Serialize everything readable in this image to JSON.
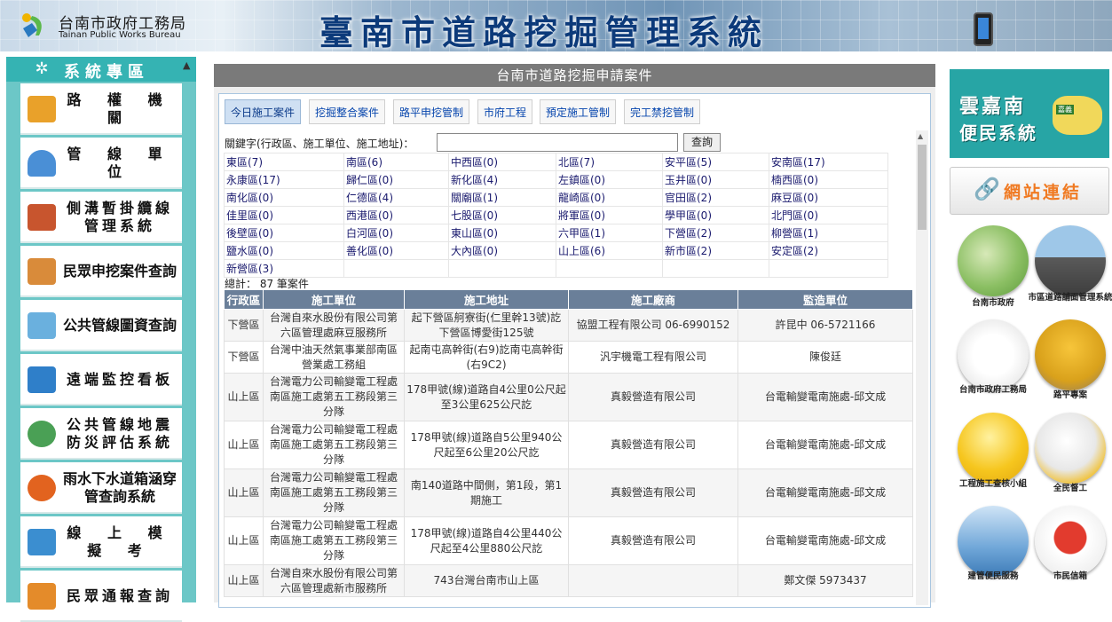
{
  "header": {
    "org_name_cn": "台南市政府工務局",
    "org_name_en": "Tainan Public Works Bureau",
    "system_title": "臺南市道路挖掘管理系統"
  },
  "sidebar": {
    "title": "系統專區",
    "items": [
      {
        "label": "路 權 機 關",
        "icon": "building-icon"
      },
      {
        "label": "管 線 單 位",
        "icon": "worker-icon"
      },
      {
        "label": "側溝暫掛纜線管理系統",
        "icon": "cable-icon"
      },
      {
        "label": "民眾申挖案件查詢",
        "icon": "folder-icon"
      },
      {
        "label": "公共管線圖資查詢",
        "icon": "map-search-icon"
      },
      {
        "label": "遠端監控看板",
        "icon": "monitor-icon"
      },
      {
        "label": "公共管線地震防災評估系統",
        "icon": "seismograph-icon"
      },
      {
        "label": "雨水下水道箱涵穿管查詢系統",
        "icon": "water-icon"
      },
      {
        "label": "線 上 模 擬 考",
        "icon": "exam-icon"
      },
      {
        "label": "民眾通報查詢",
        "icon": "report-icon"
      }
    ]
  },
  "main": {
    "title": "台南市道路挖掘申請案件",
    "tabs": [
      "今日施工案件",
      "挖掘整合案件",
      "路平申挖管制",
      "市府工程",
      "預定施工管制",
      "完工禁挖管制"
    ],
    "active_tab": "今日施工案件",
    "search": {
      "label": "關鍵字(行政區、施工單位、施工地址)：",
      "value": "",
      "button": "查詢"
    },
    "districts": [
      [
        "東區(7)",
        "南區(6)",
        "中西區(0)",
        "北區(7)",
        "安平區(5)",
        "安南區(17)"
      ],
      [
        "永康區(17)",
        "歸仁區(0)",
        "新化區(4)",
        "左鎮區(0)",
        "玉井區(0)",
        "楠西區(0)"
      ],
      [
        "南化區(0)",
        "仁德區(4)",
        "關廟區(1)",
        "龍崎區(0)",
        "官田區(2)",
        "麻豆區(0)"
      ],
      [
        "佳里區(0)",
        "西港區(0)",
        "七股區(0)",
        "將軍區(0)",
        "學甲區(0)",
        "北門區(0)"
      ],
      [
        "後壁區(0)",
        "白河區(0)",
        "東山區(0)",
        "六甲區(1)",
        "下營區(2)",
        "柳營區(1)"
      ],
      [
        "鹽水區(0)",
        "善化區(0)",
        "大內區(0)",
        "山上區(6)",
        "新市區(2)",
        "安定區(2)"
      ],
      [
        "新營區(3)",
        "",
        "",
        "",
        "",
        ""
      ]
    ],
    "total": "總計： 87 筆案件",
    "columns": [
      "行政區",
      "施工單位",
      "施工地址",
      "施工廠商",
      "監造單位"
    ],
    "rows": [
      [
        "下營區",
        "台灣自來水股份有限公司第六區管理處麻豆服務所",
        "起下營區舸寮街(仁里幹13號)訖下營區博愛街125號",
        "協盟工程有限公司 06-6990152",
        "許昆中 06-5721166"
      ],
      [
        "下營區",
        "台灣中油天然氣事業部南區營業處工務組",
        "起南屯高幹街(右9)訖南屯高幹街(右9C2)",
        "汎宇機電工程有限公司",
        "陳俊廷"
      ],
      [
        "山上區",
        "台灣電力公司輸變電工程處南區施工處第五工務段第三分隊",
        "178甲號(線)道路自4公里0公尺起至3公里625公尺訖",
        "真毅營造有限公司",
        "台電輸變電南施處-邱文成"
      ],
      [
        "山上區",
        "台灣電力公司輸變電工程處南區施工處第五工務段第三分隊",
        "178甲號(線)道路自5公里940公尺起至6公里20公尺訖",
        "真毅營造有限公司",
        "台電輸變電南施處-邱文成"
      ],
      [
        "山上區",
        "台灣電力公司輸變電工程處南區施工處第五工務段第三分隊",
        "南140道路中間側，第1段，第1期施工",
        "真毅營造有限公司",
        "台電輸變電南施處-邱文成"
      ],
      [
        "山上區",
        "台灣電力公司輸變電工程處南區施工處第五工務段第三分隊",
        "178甲號(線)道路自4公里440公尺起至4公里880公尺訖",
        "真毅營造有限公司",
        "台電輸變電南施處-邱文成"
      ],
      [
        "山上區",
        "台灣自來水股份有限公司第六區管理處新市服務所",
        "743台灣台南市山上區",
        "",
        "鄭文傑 5973437"
      ]
    ]
  },
  "right": {
    "yjn_line1": "雲嘉南",
    "yjn_line2": "便民系統",
    "yjn_tag": "嘉義",
    "links_label": "網站連結",
    "tiles": [
      {
        "label": "台南市政府",
        "icon": "tainan-map-icon"
      },
      {
        "label": "市區道路舖面管理系統",
        "icon": "road-icon"
      },
      {
        "label": "台南市政府工務局",
        "icon": "bureau-logo-icon"
      },
      {
        "label": "路平專案",
        "icon": "roller-icon"
      },
      {
        "label": "工程施工查核小組",
        "icon": "helmet-icon"
      },
      {
        "label": "全民督工",
        "icon": "magnifier-helmet-icon"
      },
      {
        "label": "建管便民服務",
        "icon": "building-service-icon"
      },
      {
        "label": "市民信箱",
        "icon": "mailbox-icon"
      }
    ]
  },
  "colors": {
    "sidebar": "#6cc7c7",
    "header_bar": "#7a7a7a",
    "table_head": "#6a7f99",
    "accent_orange": "#f07a22"
  }
}
